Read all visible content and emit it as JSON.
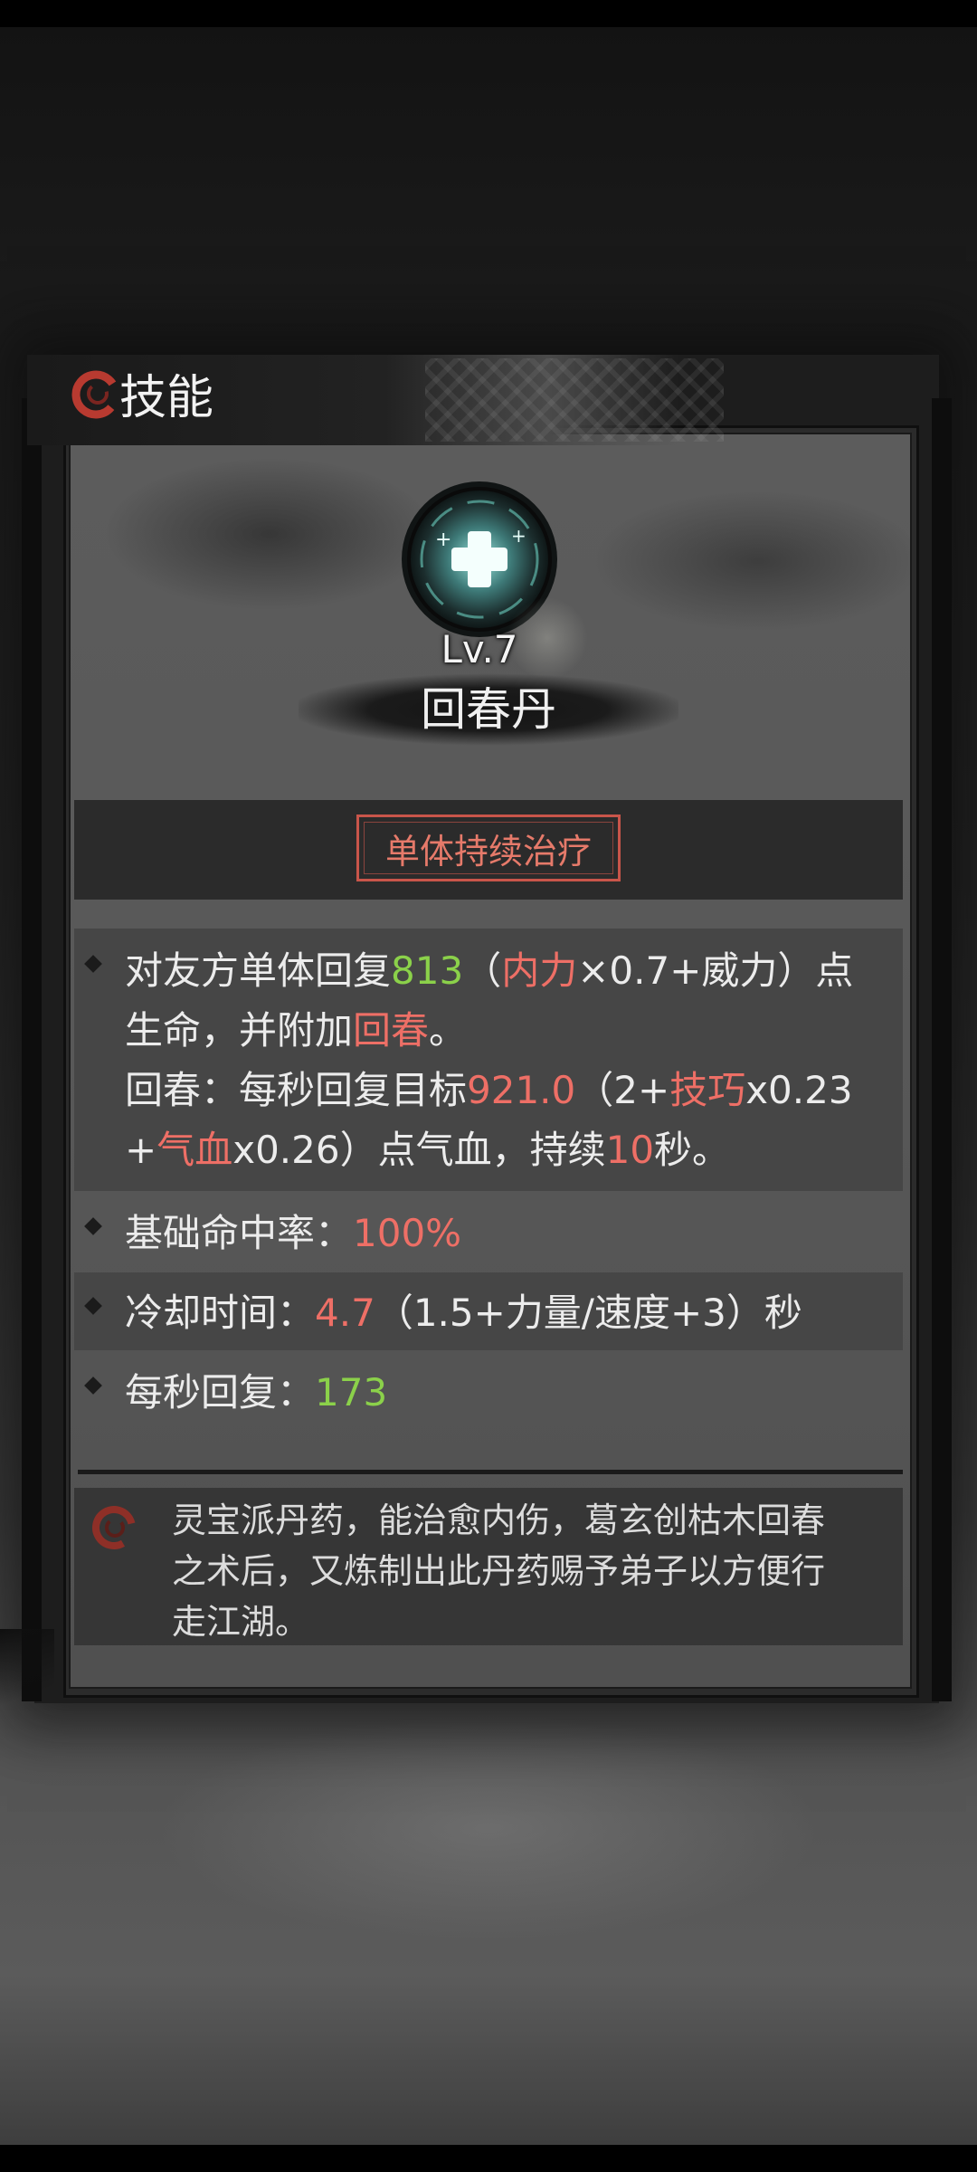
{
  "header": {
    "title": "技能",
    "icon": "swirl-icon"
  },
  "skill": {
    "level": "Lv.7",
    "name": "回春丹",
    "type": "单体持续治疗",
    "icon": "heal-cross-orb-icon"
  },
  "desc": {
    "line1": {
      "a": "对友方单体回复",
      "b": "813",
      "c": "（",
      "d": "内力",
      "e": "×0.7+威力）点"
    },
    "line2": {
      "a": "生命，并附加",
      "b": "回春",
      "c": "。"
    },
    "line3": {
      "a": "回春：每秒回复目标",
      "b": "921.0",
      "c": "（2+",
      "d": "技巧",
      "e": "x0.23"
    },
    "line4": {
      "a": "+",
      "b": "气血",
      "c": "x0.26）点气血，持续",
      "d": "10",
      "e": "秒。"
    }
  },
  "stats": {
    "hit_label": "基础命中率：",
    "hit_value": "100%",
    "cd_label": "冷却时间：",
    "cd_value": "4.7",
    "cd_formula": "（1.5+力量/速度+3）秒",
    "regen_label": "每秒回复：",
    "regen_value": "173"
  },
  "lore": {
    "line1": "灵宝派丹药，能治愈内伤，葛玄创枯木回春",
    "line2": "之术后，又炼制出此丹药赐予弟子以方便行",
    "line3": "走江湖。",
    "icon": "swirl-icon"
  },
  "colors": {
    "red": "#ee6f66",
    "green": "#8bd14a",
    "stamp": "#c9554a"
  }
}
